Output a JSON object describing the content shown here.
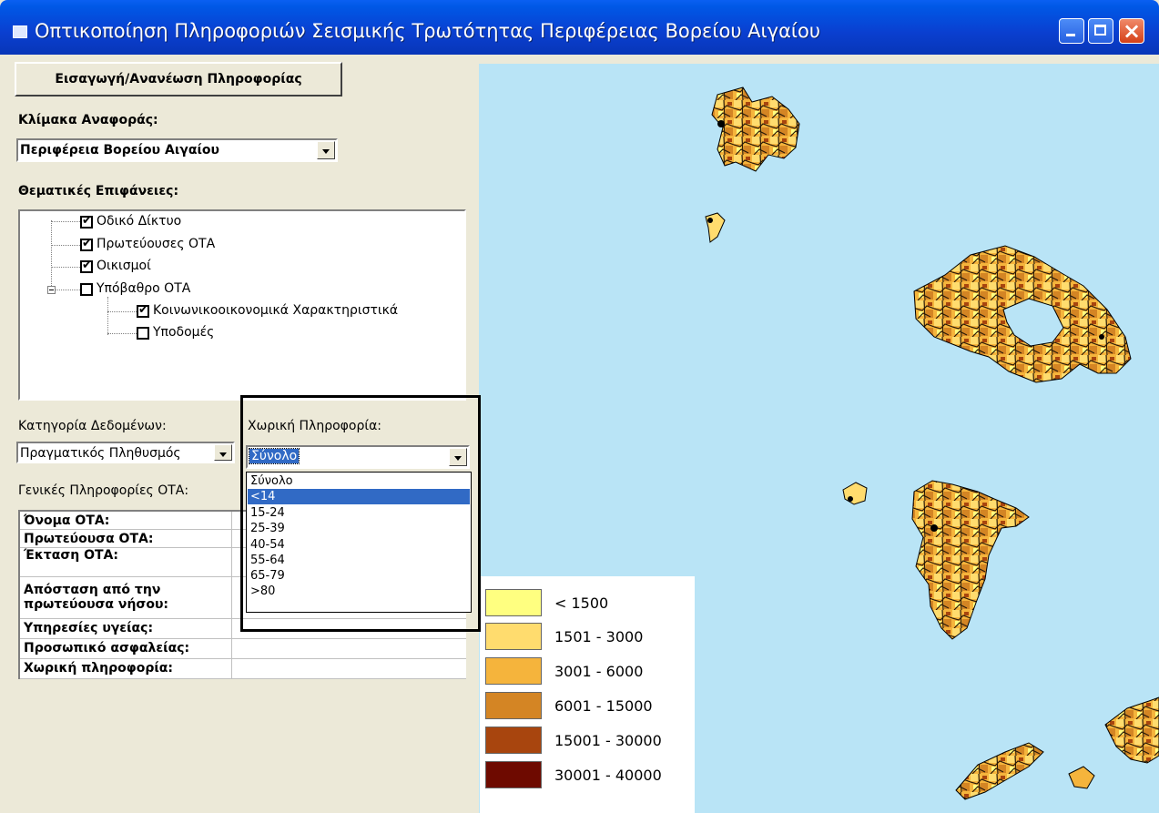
{
  "window": {
    "title": "Οπτικοποίηση Πληροφοριών Σεισμικής Τρωτότητας Περιφέρειας Βορείου Αιγαίου"
  },
  "left_panel": {
    "import_button": "Εισαγωγή/Ανανέωση Πληροφορίας",
    "scale_label": "Κλίμακα Αναφοράς:",
    "scale_value": "Περιφέρεια Βορείου Αιγαίου",
    "thematic_label": "Θεματικές Επιφάνειες:",
    "tree": [
      {
        "label": "Οδικό Δίκτυο",
        "checked": true
      },
      {
        "label": "Πρωτεύουσες ΟΤΑ",
        "checked": true
      },
      {
        "label": "Οικισμοί",
        "checked": true
      },
      {
        "label": "Υπόβαθρο ΟΤΑ",
        "checked": false
      },
      {
        "label": "Κοινωνικοοικονομικά Χαρακτηριστικά",
        "checked": true
      },
      {
        "label": "Υποδομές",
        "checked": false
      }
    ],
    "category_label": "Κατηγορία Δεδομένων:",
    "category_value": "Πραγματικός Πληθυσμός",
    "spatial_label": "Χωρική Πληροφορία:",
    "spatial_value": "Σύνολο",
    "spatial_options": [
      "Σύνολο",
      "<14",
      "15-24",
      "25-39",
      "40-54",
      "55-64",
      "65-79",
      ">80"
    ],
    "spatial_selected_option": "<14",
    "general_info_label": "Γενικές Πληροφορίες ΟΤΑ:",
    "info_rows": [
      {
        "key": "Όνομα ΟΤΑ:",
        "value": ""
      },
      {
        "key": "Πρωτεύουσα ΟΤΑ:",
        "value": ""
      },
      {
        "key": "Έκταση ΟΤΑ:",
        "value": ""
      },
      {
        "key": "Απόσταση από την πρωτεύουσα νήσου:",
        "value": ""
      },
      {
        "key": "Υπηρεσίες υγείας:",
        "value": ""
      },
      {
        "key": "Προσωπικό ασφαλείας:",
        "value": ""
      },
      {
        "key": "Χωρική πληροφορία:",
        "value": ""
      }
    ]
  },
  "legend": [
    {
      "label": "< 1500",
      "color": "#ffff80"
    },
    {
      "label": "1501 - 3000",
      "color": "#ffdc6e"
    },
    {
      "label": "3001 - 6000",
      "color": "#f5b43c"
    },
    {
      "label": "6001 - 15000",
      "color": "#d48524"
    },
    {
      "label": "15001 - 30000",
      "color": "#a8450e"
    },
    {
      "label": "30001 - 40000",
      "color": "#6e0a00"
    }
  ],
  "colors": {
    "sea": "#b9e4f6",
    "selection": "#316ac5"
  }
}
